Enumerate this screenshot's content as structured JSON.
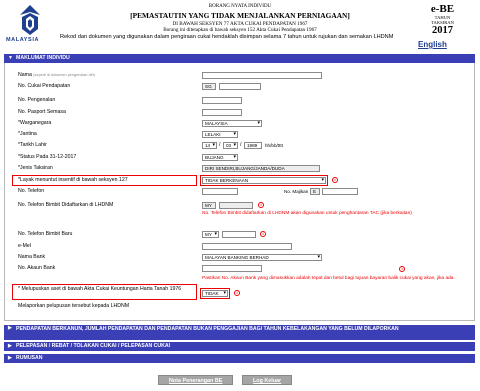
{
  "header": {
    "logo_text": "MALAYSIA",
    "form_type_small": "BORANG NYATA INDIVIDU",
    "title": "[PEMASTAUTIN YANG TIDAK MENJALANKAN PERNIAGAAN]",
    "section_line": "DI BAWAH SEKSYEN 77 AKTA CUKAI PENDAPATAN 1967",
    "prescribed_line": "Borang ini ditetapkan di bawah seksyen 152 Akta Cukai Pendapatan 1967",
    "notice": "Rekod dan dokumen yang digunakan dalam pengiraan cukai hendaklah disimpan selama 7 tahun untuk rujukan dan semakan LHDNM",
    "form_code": "e-BE",
    "tahun_label": "TAHUN",
    "taksiran_label": "TAKSIRAN",
    "year": "2017",
    "english_link": "English"
  },
  "sections": {
    "maklumat": "MAKLUMAT INDIVIDU",
    "pendapatan": "PENDAPATAN BERKANUN, JUMLAH PENDAPATAN DAN PENDAPATAN BUKAN PENGGAJIAN BAGI TAHUN KEBELAKANGAN YANG BELUM DILAPORKAN",
    "pelepasan": "PELEPASAN / REBAT / TOLAKAN CUKAI / PELEPASAN CUKAI",
    "rumusan": "RUMUSAN"
  },
  "form": {
    "nama_label": "Nama",
    "nama_hint": "(seperti di dokumen pengenalan diri)",
    "cukai_label": "No. Cukai Pendapatan",
    "cukai_prefix": "SG",
    "pengenalan_label": "No. Pengenalan",
    "pasport_label": "No. Pasport Semasa",
    "warga_label": "*Warganegara",
    "warga_value": "MALAYSIA",
    "jantina_label": "*Jantina",
    "jantina_value": "LELAKI",
    "tarikh_label": "*Tarikh Lahir",
    "tarikh_day": "14",
    "tarikh_month": "03",
    "tarikh_year": "1989",
    "tarikh_format": "hh/bb/tttt",
    "status_label": "*Status Pada 31-12-2017",
    "status_value": "BUJANG",
    "jenis_label": "*Jenis Taksiran",
    "jenis_value": "DIRI SENDIRI,BUJANG/JANDA/DUDA",
    "layak_label": "*Layak menuntut insentif di bawah seksyen 127",
    "layak_value": "TIDAK BERKENAAN",
    "telefon_label": "No. Telefon",
    "majikan_label": "No. Majikan",
    "majikan_prefix": "E",
    "bimbit_lhdn_label": "No. Telefon Bimbit Didaftarkan di LHDNM",
    "bimbit_lhdn_prefix": "MY",
    "bimbit_note": "No. Telefon Bimbit didaftarkan di LHDNM akan digunakan untuk penghantaran TAC (jika berkaitan)",
    "bimbit_baru_label": "No. Telefon Bimbit Baru",
    "bimbit_baru_prefix": "MY",
    "emel_label": "e-Mel",
    "bank_label": "Nama Bank",
    "bank_value": "MALAYAN BANKING BERHAD",
    "akaun_label": "No. Akaun Bank",
    "akaun_note": "Pastikan No. Akaun Bank yang dimasukkan adalah tepat dan betul bagi tujuan bayaran balik cukai yang akan, jika ada.",
    "pelupusan_label": "* Melupuskan aset di bawah Akta Cukai Keuntungan Harta Tanah 1976",
    "pelupusan_value": "TIDAK",
    "melaporkan_label": "Melaporkan pelupusan tersebut kepada LHDNM"
  },
  "footer": {
    "nota_button": "Nota Penerangan BE",
    "logout_button": "Log Keluar"
  },
  "colors": {
    "bar": "#3b3fb6",
    "alert": "#ee0000",
    "brand": "#1f3f8f"
  }
}
